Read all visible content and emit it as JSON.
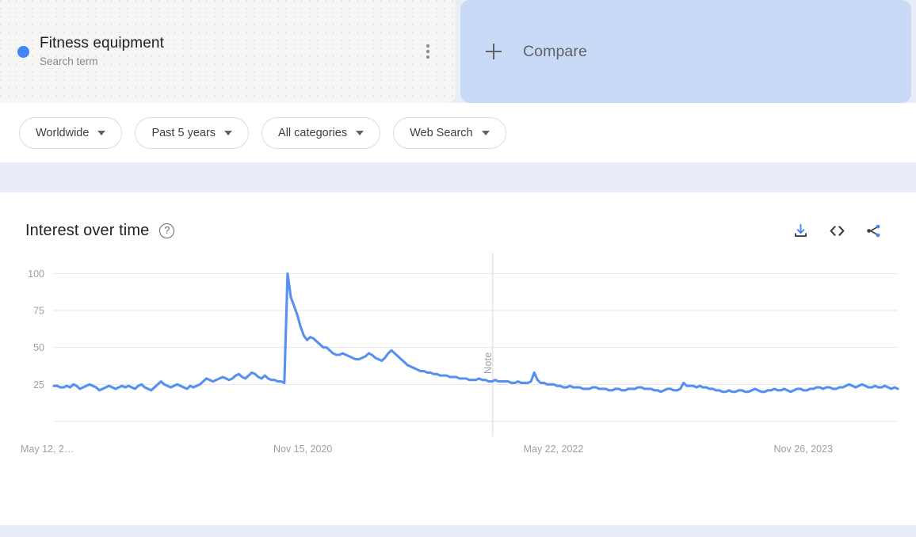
{
  "search_term": {
    "title": "Fitness equipment",
    "subtitle": "Search term",
    "dot_color": "#4285f4",
    "menu_icon": "kebab-menu-icon"
  },
  "compare": {
    "label": "Compare",
    "plus_icon": "plus-icon",
    "background_color": "#c9daf6"
  },
  "filters": [
    {
      "label": "Worldwide"
    },
    {
      "label": "Past 5 years"
    },
    {
      "label": "All categories"
    },
    {
      "label": "Web Search"
    }
  ],
  "chart_panel": {
    "title": "Interest over time",
    "help_icon": "help-circle-icon",
    "actions": [
      {
        "name": "download-icon",
        "label": "Download"
      },
      {
        "name": "embed-code-icon",
        "label": "Embed"
      },
      {
        "name": "share-icon",
        "label": "Share"
      }
    ]
  },
  "chart_data": {
    "type": "line",
    "title": "Interest over time",
    "xlabel": "",
    "ylabel": "",
    "ylim": [
      0,
      105
    ],
    "y_ticks": [
      25,
      50,
      75,
      100
    ],
    "y_tick_labels": [
      "25",
      "50",
      "75",
      "100"
    ],
    "x_tick_labels": [
      "May 12, 2…",
      "Nov 15, 2020",
      "May 22, 2022",
      "Nov 26, 2023"
    ],
    "x_tick_positions": [
      0,
      0.295,
      0.592,
      0.888
    ],
    "grid": true,
    "legend": "none",
    "line_color": "#5690f0",
    "annotations": [
      {
        "label": "Note",
        "x_fraction": 0.52,
        "orientation": "vertical"
      }
    ],
    "series": [
      {
        "name": "Fitness equipment",
        "color": "#5690f0",
        "values": [
          24,
          24,
          23,
          23,
          24,
          23,
          25,
          24,
          22,
          23,
          24,
          25,
          24,
          23,
          21,
          22,
          23,
          24,
          23,
          22,
          23,
          24,
          23,
          24,
          23,
          22,
          24,
          25,
          23,
          22,
          21,
          23,
          25,
          27,
          25,
          24,
          23,
          24,
          25,
          24,
          23,
          22,
          24,
          23,
          24,
          25,
          27,
          29,
          28,
          27,
          28,
          29,
          30,
          29,
          28,
          29,
          31,
          32,
          30,
          29,
          31,
          33,
          32,
          30,
          29,
          31,
          29,
          28,
          28,
          27,
          27,
          26,
          100,
          84,
          78,
          72,
          64,
          58,
          55,
          57,
          56,
          54,
          52,
          50,
          50,
          48,
          46,
          45,
          45,
          46,
          45,
          44,
          43,
          42,
          42,
          43,
          44,
          46,
          45,
          43,
          42,
          41,
          43,
          46,
          48,
          46,
          44,
          42,
          40,
          38,
          37,
          36,
          35,
          34,
          34,
          33,
          33,
          32,
          32,
          31,
          31,
          31,
          30,
          30,
          30,
          29,
          29,
          29,
          28,
          28,
          28,
          29,
          28,
          28,
          27,
          27,
          28,
          27,
          27,
          27,
          27,
          26,
          26,
          27,
          26,
          26,
          26,
          27,
          33,
          28,
          26,
          26,
          25,
          25,
          25,
          24,
          24,
          23,
          23,
          24,
          23,
          23,
          23,
          22,
          22,
          22,
          23,
          23,
          22,
          22,
          22,
          21,
          21,
          22,
          22,
          21,
          21,
          22,
          22,
          22,
          23,
          23,
          22,
          22,
          22,
          21,
          21,
          20,
          21,
          22,
          22,
          21,
          21,
          22,
          26,
          24,
          24,
          24,
          23,
          24,
          23,
          23,
          22,
          22,
          21,
          21,
          20,
          20,
          21,
          20,
          20,
          21,
          21,
          20,
          20,
          21,
          22,
          21,
          20,
          20,
          21,
          21,
          22,
          21,
          21,
          22,
          21,
          20,
          21,
          22,
          22,
          21,
          21,
          22,
          22,
          23,
          23,
          22,
          23,
          23,
          22,
          22,
          23,
          23,
          24,
          25,
          24,
          23,
          24,
          25,
          24,
          23,
          23,
          24,
          23,
          23,
          24,
          23,
          22,
          23,
          22
        ]
      }
    ]
  }
}
